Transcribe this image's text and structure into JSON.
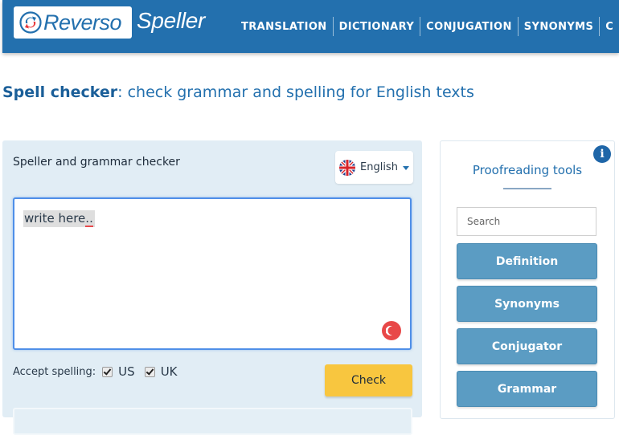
{
  "header": {
    "logo_text": "Reverso",
    "product_name": "Speller",
    "nav": [
      {
        "label": "TRANSLATION"
      },
      {
        "label": "DICTIONARY"
      },
      {
        "label": "CONJUGATION"
      },
      {
        "label": "SYNONYMS"
      },
      {
        "label": "C"
      }
    ]
  },
  "page": {
    "title_strong": "Spell checker",
    "title_rest": ": check grammar and spelling for English texts"
  },
  "checker": {
    "title": "Speller and grammar checker",
    "language": "English",
    "editor_text": "write here",
    "editor_text_error": "..",
    "accept_label": "Accept spelling:",
    "options": [
      {
        "label": "US",
        "checked": true
      },
      {
        "label": "UK",
        "checked": true
      }
    ],
    "check_label": "Check"
  },
  "tools": {
    "title": "Proofreading tools",
    "search_placeholder": "Search",
    "buttons": [
      {
        "label": "Definition"
      },
      {
        "label": "Synonyms"
      },
      {
        "label": "Conjugator"
      },
      {
        "label": "Grammar"
      }
    ]
  },
  "colors": {
    "brand_blue": "#2370ae",
    "check_yellow": "#f8c63f",
    "tool_button": "#5b9cc3",
    "error_red": "#e84848"
  }
}
